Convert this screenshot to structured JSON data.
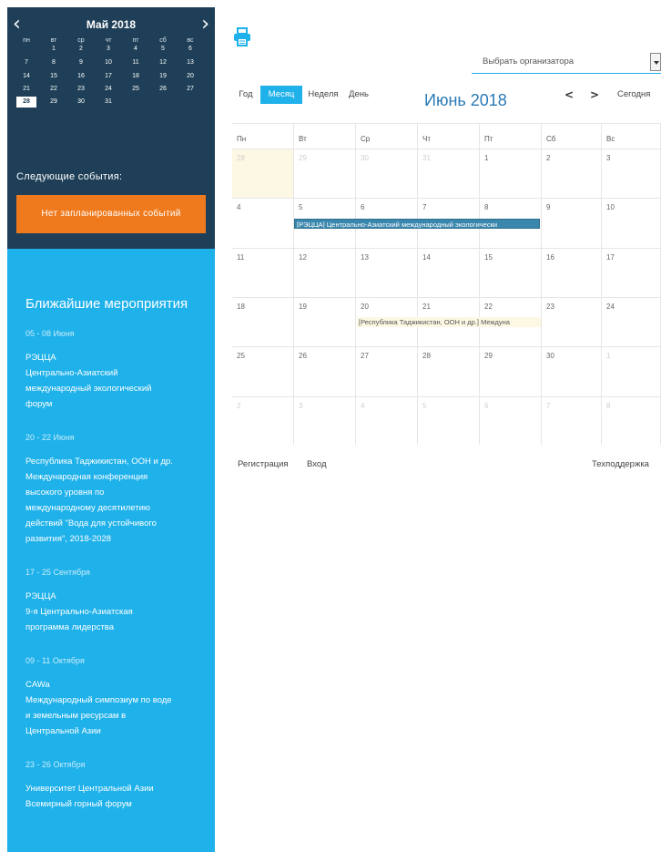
{
  "mini_calendar": {
    "title": "Май 2018",
    "prev_icon": "chevron-left-icon",
    "next_icon": "chevron-right-icon",
    "weekdays": [
      "пн",
      "вт",
      "ср",
      "чт",
      "пт",
      "сб",
      "вс"
    ],
    "weeks": [
      [
        "",
        "1",
        "2",
        "3",
        "4",
        "5",
        "6"
      ],
      [
        "7",
        "8",
        "9",
        "10",
        "11",
        "12",
        "13"
      ],
      [
        "14",
        "15",
        "16",
        "17",
        "18",
        "19",
        "20"
      ],
      [
        "21",
        "22",
        "23",
        "24",
        "25",
        "26",
        "27"
      ],
      [
        "28",
        "29",
        "30",
        "31",
        "",
        "",
        ""
      ]
    ],
    "today": "28"
  },
  "next_events": {
    "label": "Следующие события:",
    "empty_text": "Нет запланированных событий"
  },
  "upcoming": {
    "title": "Ближайшие мероприятия",
    "items": [
      {
        "date": "05 - 08 Июня",
        "org": "РЭЦЦА",
        "lines": [
          "Центрально-Азиатский",
          "международный экологический",
          "форум"
        ]
      },
      {
        "date": "20 - 22 Июня",
        "org": "",
        "lines": [
          "Республика Таджикистан, ООН и др.",
          "Международная конференция",
          "высокого уровня по",
          "международному десятилетию",
          "действий \"Вода для устойчивого",
          "развития\", 2018-2028"
        ]
      },
      {
        "date": "17 - 25 Сентября",
        "org": "РЭЦЦА",
        "lines": [
          "9-я Центрально-Азиатская",
          "программа лидерства"
        ]
      },
      {
        "date": "09 - 11 Октября",
        "org": "CAWa",
        "lines": [
          "Международный симпозиум по воде",
          "и земельным ресурсам в",
          "Центральной Азии"
        ]
      },
      {
        "date": "23 - 26 Октября",
        "org": "",
        "lines": [
          "Университет Центральной Азии",
          "Всемирный горный форум"
        ]
      }
    ]
  },
  "toolbar": {
    "print_icon": "printer-icon",
    "organizer_placeholder": "Выбрать организатора",
    "views": [
      "Год",
      "Месяц",
      "Неделя",
      "День"
    ],
    "active_view": "Месяц",
    "month_title": "Июнь 2018",
    "prev": "<",
    "next": ">",
    "today": "Сегодня"
  },
  "month_grid": {
    "weekdays": [
      "Пн",
      "Вт",
      "Ср",
      "Чт",
      "Пт",
      "Сб",
      "Вс"
    ],
    "weeks": [
      [
        "28",
        "29",
        "30",
        "31",
        "1",
        "2",
        "3"
      ],
      [
        "4",
        "5",
        "6",
        "7",
        "8",
        "9",
        "10"
      ],
      [
        "11",
        "12",
        "13",
        "14",
        "15",
        "16",
        "17"
      ],
      [
        "18",
        "19",
        "20",
        "21",
        "22",
        "23",
        "24"
      ],
      [
        "25",
        "26",
        "27",
        "28",
        "29",
        "30",
        "1"
      ],
      [
        "2",
        "3",
        "4",
        "5",
        "6",
        "7",
        "8"
      ]
    ],
    "events": [
      {
        "title": "[РЭЦЦА] Центрально-Азиатский международный экологически",
        "color": "#3a87ad"
      },
      {
        "title": "[Республика Таджикистан, ООН и др.] Междуна",
        "color": "#fcf8e3"
      }
    ]
  },
  "footer": {
    "register": "Регистрация",
    "login": "Вход",
    "support": "Техподдержка"
  },
  "colors": {
    "sidebar_dark": "#1e3f57",
    "sidebar_light": "#1fb1ea",
    "accent_orange": "#ef7a1d",
    "title_blue": "#2a7ab5"
  }
}
